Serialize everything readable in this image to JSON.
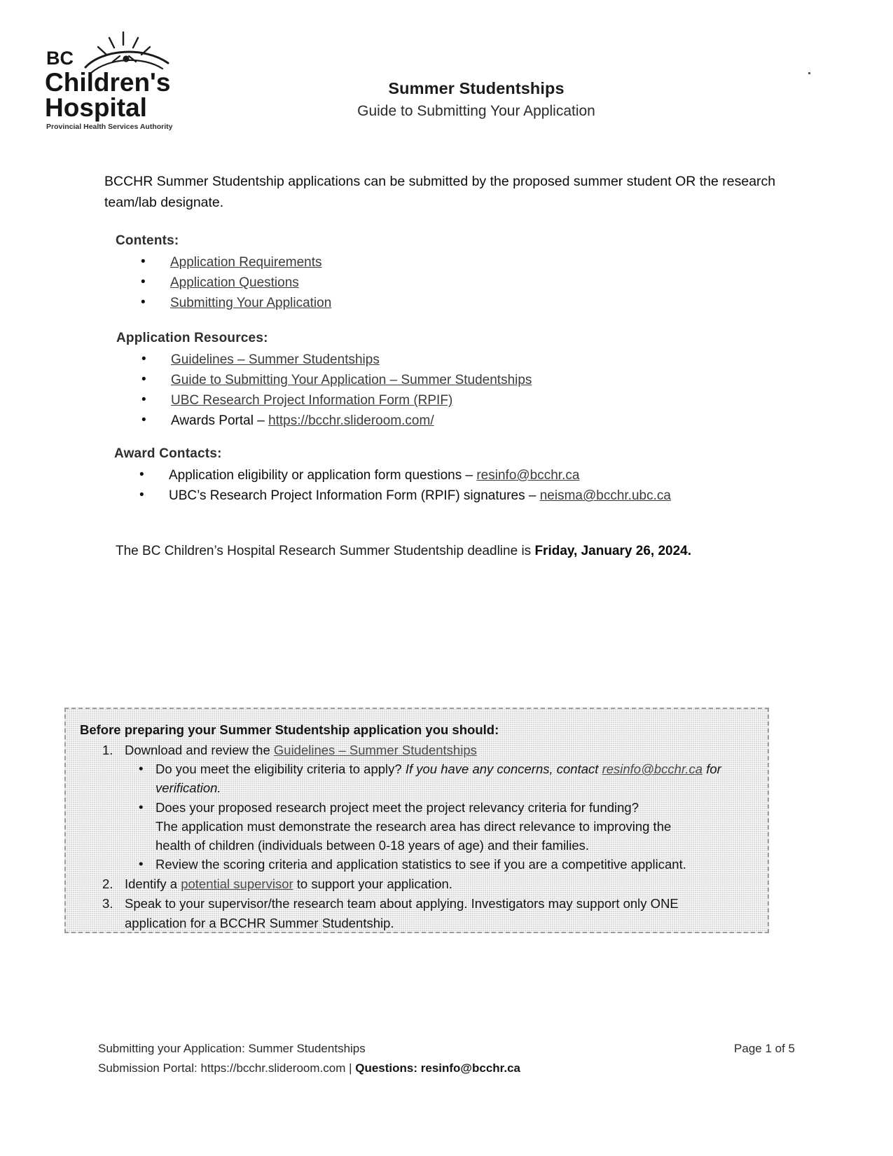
{
  "header": {
    "logo": {
      "line1": "BC",
      "line2": "Children's",
      "line3": "Hospital",
      "tagline": "Provincial Health Services Authority"
    },
    "title": "Summer Studentships",
    "subtitle": "Guide to Submitting Your Application"
  },
  "intro": "BCCHR Summer Studentship applications can be submitted by the proposed summer student OR the research team/lab designate.",
  "contents": {
    "heading": "Contents:",
    "items": [
      "Application Requirements",
      "Application Questions",
      "Submitting Your Application"
    ]
  },
  "resources": {
    "heading": "Application Resources:",
    "items": [
      {
        "link": "Guidelines – Summer Studentships"
      },
      {
        "link": "Guide to Submitting Your Application – Summer Studentships"
      },
      {
        "link": "UBC Research Project Information Form (RPIF)"
      },
      {
        "prefix": "Awards Portal – ",
        "link": "https://bcchr.slideroom.com/"
      }
    ]
  },
  "contacts": {
    "heading": "Award Contacts:",
    "items": [
      {
        "prefix": "Application eligibility or application form questions – ",
        "link": "resinfo@bcchr.ca"
      },
      {
        "prefix": "UBC’s Research Project Information Form (RPIF) signatures – ",
        "link": "neisma@bcchr.ubc.ca"
      }
    ]
  },
  "deadline": {
    "text": "The BC Children’s Hospital Research Summer Studentship deadline is ",
    "bold": "Friday, January 26, 2024."
  },
  "callout": {
    "title": "Before preparing your Summer Studentship application you should:",
    "step1_prefix": "Download and review the ",
    "step1_link": "Guidelines – Summer Studentships",
    "sub1_plain": "Do you meet the eligibility criteria to apply? ",
    "sub1_italic": "If you have any concerns, contact ",
    "sub1_link": "resinfo@bcchr.ca",
    "sub1_italic_end": " for verification.",
    "sub2_line1": "Does your proposed research project meet the project relevancy criteria for funding?",
    "sub2_line2": "The application must demonstrate the research area has direct relevance to improving the",
    "sub2_line3": "health of children (individuals between 0-18 years of age) and their families.",
    "sub3": "Review the scoring criteria and application statistics to see if you are a competitive applicant.",
    "step2_prefix": "Identify a ",
    "step2_link": "potential supervisor",
    "step2_suffix": " to support your application.",
    "step3_line1": "Speak to your supervisor/the research team about applying. Investigators may support only ONE",
    "step3_line2": "application for a BCCHR Summer Studentship."
  },
  "footer": {
    "left_line1": "Submitting your Application: Summer Studentships",
    "right_line1": "Page 1 of 5",
    "left_line2_prefix": "Submission Portal: https://bcchr.slideroom.com | ",
    "left_line2_bold": "Questions: resinfo@bcchr.ca"
  }
}
